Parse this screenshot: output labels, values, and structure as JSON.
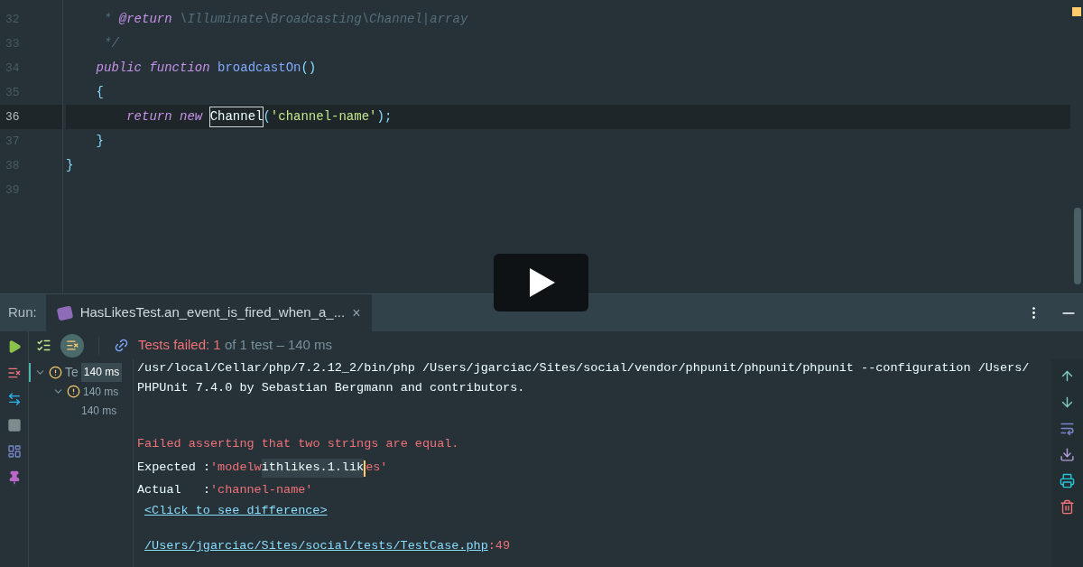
{
  "editor": {
    "lines": [
      {
        "number": "32",
        "current": false,
        "tokens": [
          {
            "kind": "comment",
            "text": "     * "
          },
          {
            "kind": "doctag",
            "text": "@return"
          },
          {
            "kind": "comment",
            "text": " \\Illuminate\\Broadcasting\\Channel|array"
          }
        ]
      },
      {
        "number": "33",
        "current": false,
        "tokens": [
          {
            "kind": "comment",
            "text": "     */"
          }
        ]
      },
      {
        "number": "34",
        "current": false,
        "tokens": [
          {
            "kind": "keyword",
            "text": "    public function "
          },
          {
            "kind": "function",
            "text": "broadcastOn"
          },
          {
            "kind": "punct",
            "text": "()"
          }
        ]
      },
      {
        "number": "35",
        "current": false,
        "tokens": [
          {
            "kind": "punct",
            "text": "    {"
          }
        ]
      },
      {
        "number": "36",
        "current": true,
        "tokens": [
          {
            "kind": "keyword",
            "text": "        return new "
          },
          {
            "kind": "matched",
            "text": "Channel"
          },
          {
            "kind": "punct",
            "text": "("
          },
          {
            "kind": "string",
            "text": "'channel-name'"
          },
          {
            "kind": "punct",
            "text": ");"
          }
        ]
      },
      {
        "number": "37",
        "current": false,
        "tokens": [
          {
            "kind": "punct",
            "text": "    }"
          }
        ]
      },
      {
        "number": "38",
        "current": false,
        "tokens": [
          {
            "kind": "punct",
            "text": "}"
          }
        ]
      },
      {
        "number": "39",
        "current": false
      }
    ]
  },
  "run": {
    "label": "Run:",
    "tab": {
      "title": "HasLikesTest.an_event_is_fired_when_a_...",
      "close": "×"
    },
    "status": {
      "failed": "Tests failed: 1",
      "rest": " of 1 test – 140 ms"
    },
    "filter_failed_on": true,
    "tree": [
      {
        "label": "Te",
        "duration": "140 ms",
        "selected": true,
        "children": [
          {
            "duration": "140 ms",
            "selected": false,
            "children": [
              {
                "duration": "140 ms",
                "selected": false
              }
            ]
          }
        ]
      }
    ],
    "console": [
      {
        "kind": "command",
        "text": "/usr/local/Cellar/php/7.2.12_2/bin/php /Users/jgarciac/Sites/social/vendor/phpunit/phpunit/phpunit --configuration /Users/"
      },
      {
        "kind": "plain",
        "text": "PHPUnit 7.4.0 by Sebastian Bergmann and contributors."
      },
      {
        "kind": "error",
        "text": "Failed asserting that two strings are equal."
      },
      {
        "kind": "compare",
        "label": "Expected :",
        "segments": [
          {
            "kind": "value",
            "text": "'modelw"
          },
          {
            "kind": "diff",
            "text": "ithlikes.1.lik"
          },
          {
            "kind": "cursor"
          },
          {
            "kind": "value",
            "text": "es'"
          }
        ]
      },
      {
        "kind": "compare",
        "label": "Actual   :",
        "segments": [
          {
            "kind": "value",
            "text": "'channel-name'"
          }
        ]
      },
      {
        "kind": "link",
        "text": "<Click to see difference>"
      },
      {
        "kind": "location",
        "text": "/Users/jgarciac/Sites/social/tests/TestCase.php",
        "suffix": ":49"
      }
    ]
  }
}
